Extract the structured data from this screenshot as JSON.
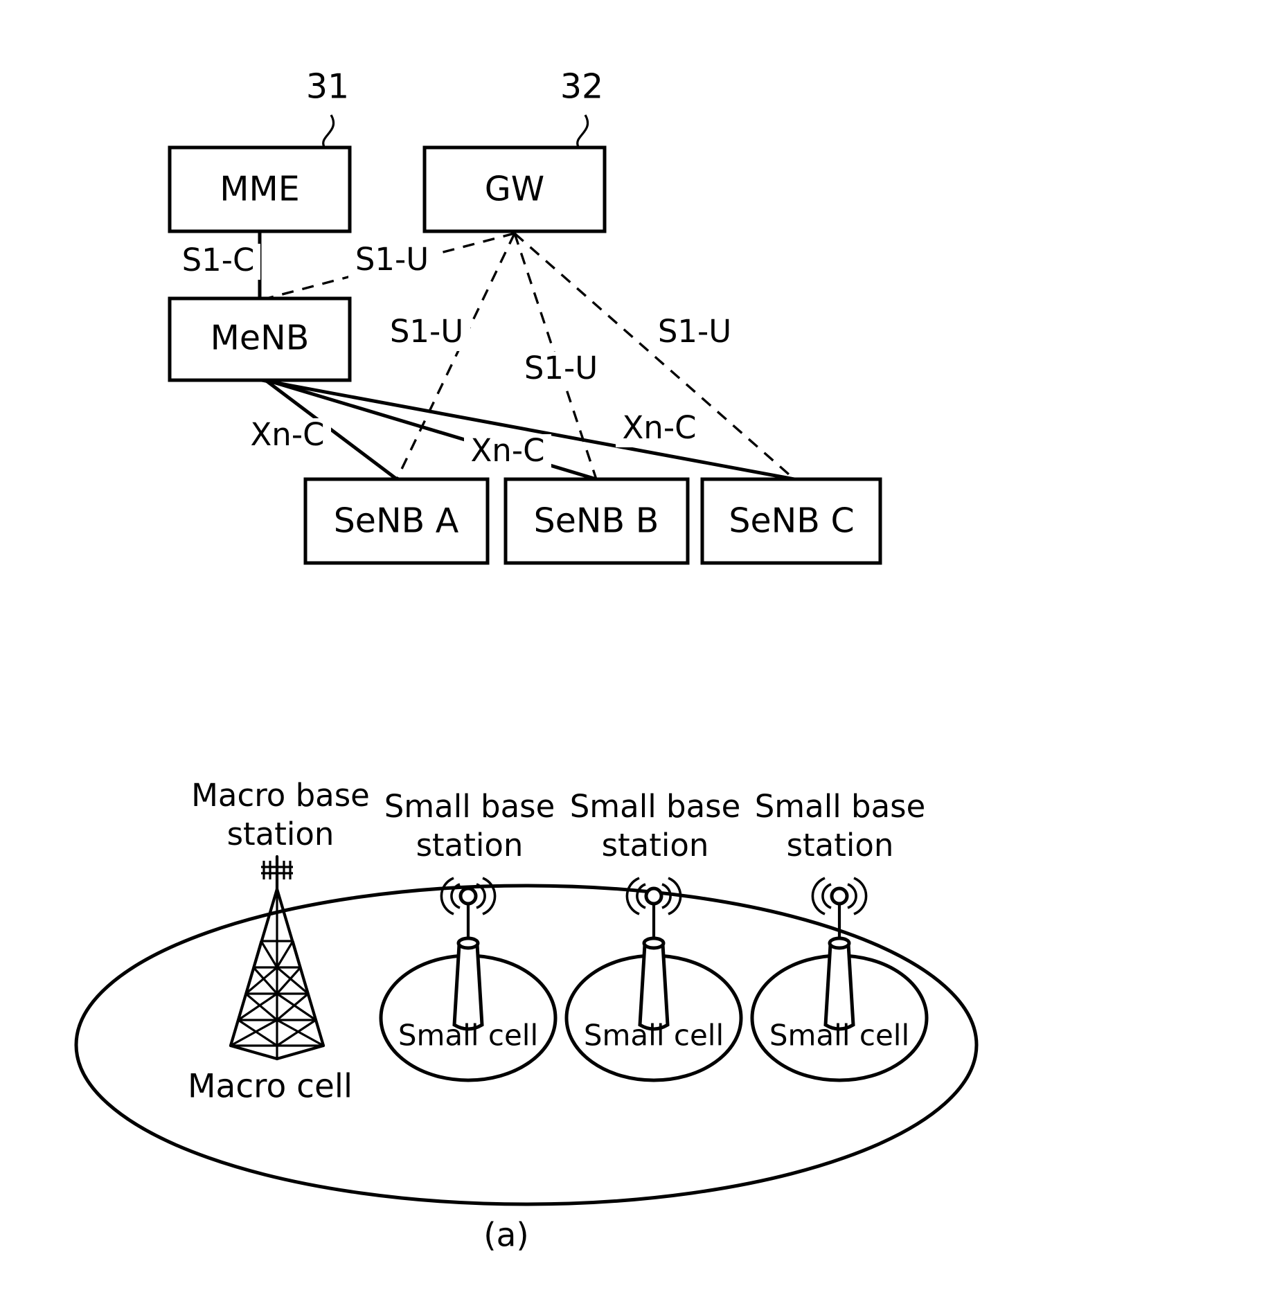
{
  "figure": {
    "caption": "(a)",
    "reference_numerals": [
      {
        "id": "ref-31",
        "label": "31",
        "points_to": "MME"
      },
      {
        "id": "ref-32",
        "label": "32",
        "points_to": "GW"
      }
    ]
  },
  "network_diagram": {
    "nodes": [
      {
        "id": "mme",
        "label": "MME"
      },
      {
        "id": "gw",
        "label": "GW"
      },
      {
        "id": "menb",
        "label": "MeNB"
      },
      {
        "id": "senb_a",
        "label": "SeNB A"
      },
      {
        "id": "senb_b",
        "label": "SeNB B"
      },
      {
        "id": "senb_c",
        "label": "SeNB C"
      }
    ],
    "links": [
      {
        "id": "link-s1c",
        "label": "S1-C",
        "from": "mme",
        "to": "menb",
        "style": "solid"
      },
      {
        "id": "link-s1u-menb",
        "label": "S1-U",
        "from": "gw",
        "to": "menb",
        "style": "dashed"
      },
      {
        "id": "link-s1u-senb-a",
        "label": "S1-U",
        "from": "gw",
        "to": "senb_a",
        "style": "dashed"
      },
      {
        "id": "link-s1u-senb-b",
        "label": "S1-U",
        "from": "gw",
        "to": "senb_b",
        "style": "dashed"
      },
      {
        "id": "link-s1u-senb-c",
        "label": "S1-U",
        "from": "gw",
        "to": "senb_c",
        "style": "dashed"
      },
      {
        "id": "link-xnc-senb-a",
        "label": "Xn-C",
        "from": "menb",
        "to": "senb_a",
        "style": "solid"
      },
      {
        "id": "link-xnc-senb-b",
        "label": "Xn-C",
        "from": "menb",
        "to": "senb_b",
        "style": "solid"
      },
      {
        "id": "link-xnc-senb-c",
        "label": "Xn-C",
        "from": "menb",
        "to": "senb_c",
        "style": "solid"
      }
    ]
  },
  "coverage_diagram": {
    "macro_cell_label": "Macro cell",
    "macro_station_caption_line1": "Macro base",
    "macro_station_caption_line2": "station",
    "small_cells": [
      {
        "id": "small-cell-1",
        "cell_label": "Small cell",
        "station_caption_line1": "Small base",
        "station_caption_line2": "station"
      },
      {
        "id": "small-cell-2",
        "cell_label": "Small cell",
        "station_caption_line1": "Small base",
        "station_caption_line2": "station"
      },
      {
        "id": "small-cell-3",
        "cell_label": "Small cell",
        "station_caption_line1": "Small base",
        "station_caption_line2": "station"
      }
    ]
  },
  "colors": {
    "ink": "#000000",
    "paper": "#ffffff"
  }
}
